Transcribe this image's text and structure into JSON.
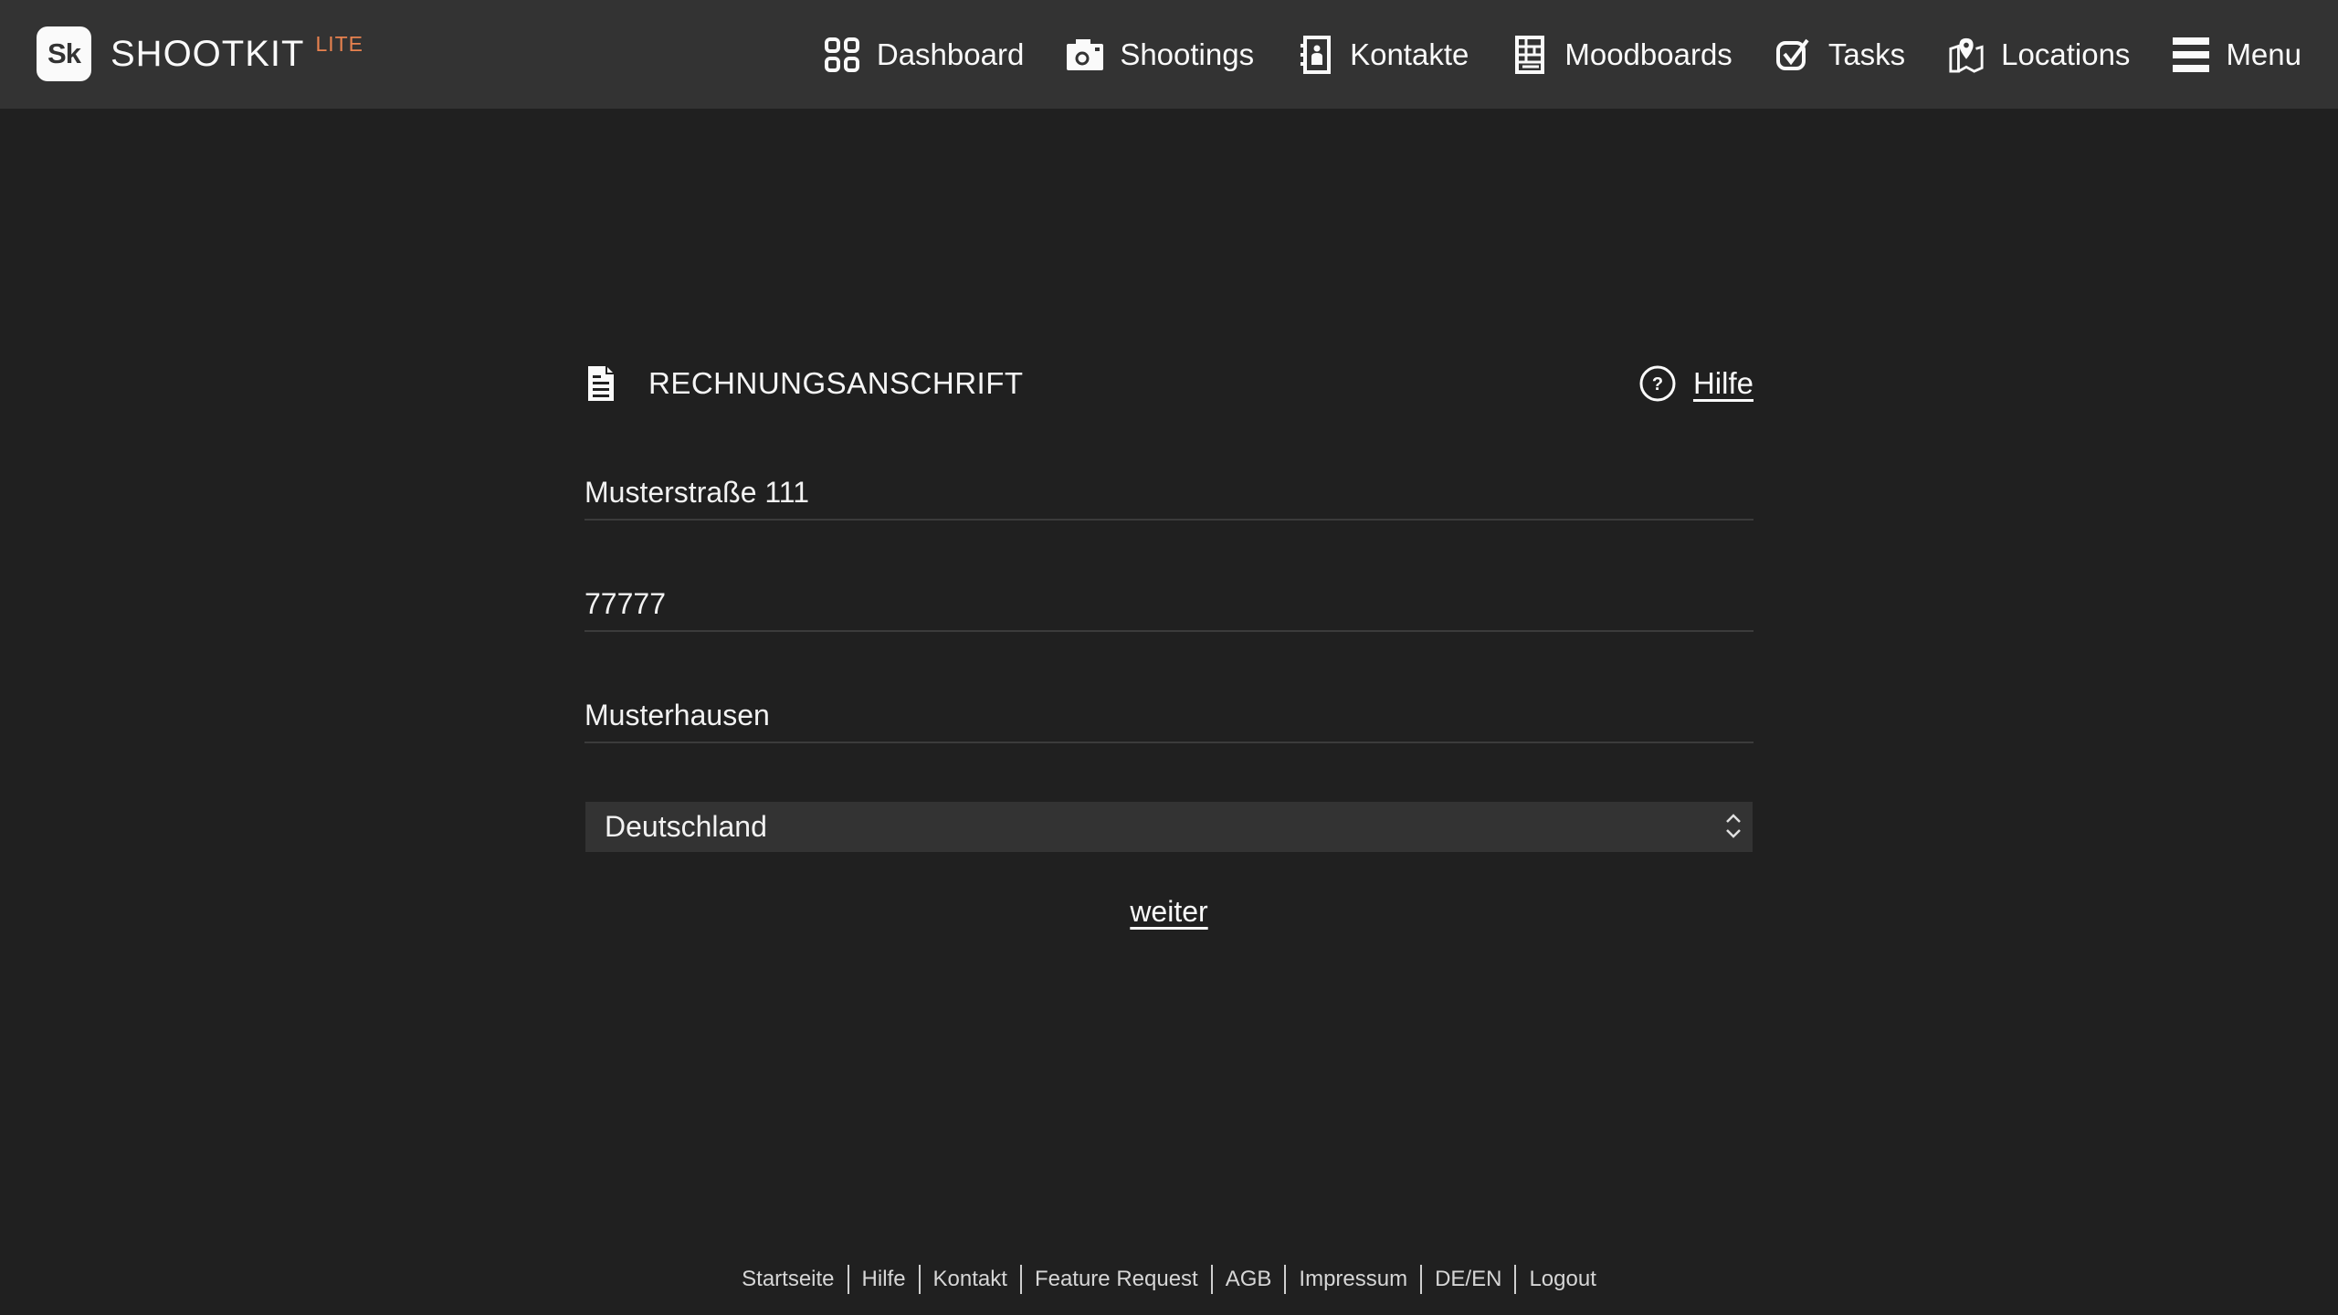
{
  "header": {
    "logo_text": "Sk",
    "app_name": "SHOOTKIT",
    "tier": "LITE",
    "tier_color": "#e8824f",
    "nav": [
      {
        "label": "Dashboard",
        "icon": "dashboard-grid-icon"
      },
      {
        "label": "Shootings",
        "icon": "camera-icon"
      },
      {
        "label": "Kontakte",
        "icon": "address-book-icon"
      },
      {
        "label": "Moodboards",
        "icon": "moodboard-icon"
      },
      {
        "label": "Tasks",
        "icon": "checkbox-icon"
      },
      {
        "label": "Locations",
        "icon": "map-pin-icon"
      },
      {
        "label": "Menu",
        "icon": "hamburger-icon"
      }
    ]
  },
  "form": {
    "section_icon": "document-icon",
    "title": "RECHNUNGSANSCHRIFT",
    "help_label": "Hilfe",
    "help_icon": "question-circle-icon",
    "street": "Musterstraße 111",
    "zip": "77777",
    "city": "Musterhausen",
    "country": "Deutschland",
    "next_label": "weiter"
  },
  "footer": {
    "links": [
      "Startseite",
      "Hilfe",
      "Kontakt",
      "Feature Request",
      "AGB",
      "Impressum",
      "DE/EN",
      "Logout"
    ]
  }
}
